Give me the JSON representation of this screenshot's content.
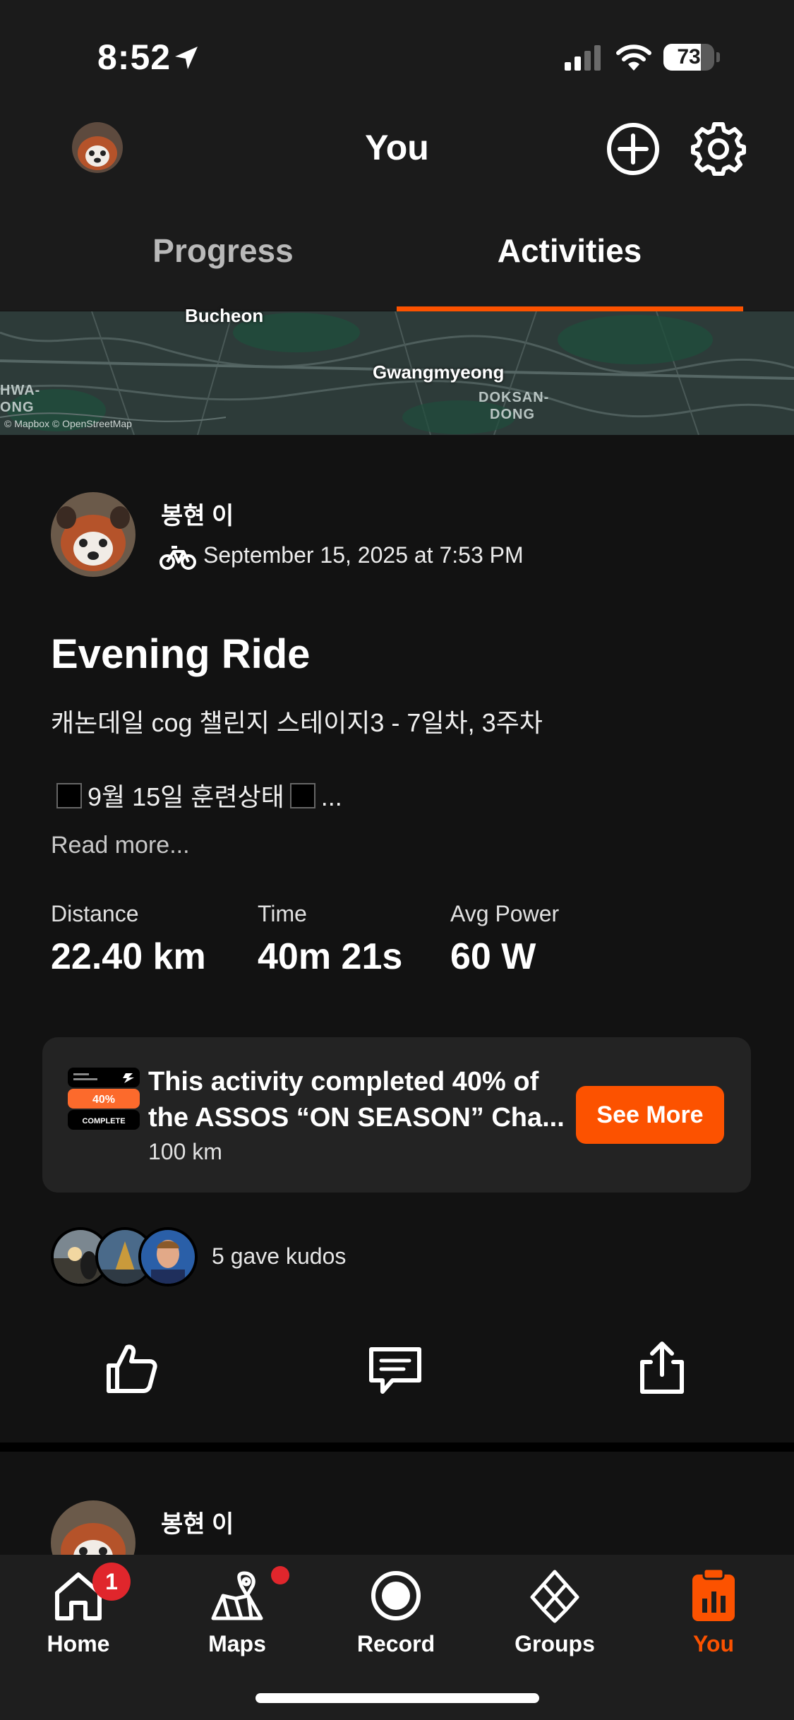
{
  "status_bar": {
    "time": "8:52",
    "battery": "73",
    "battery_level": 0.73
  },
  "header": {
    "title": "You",
    "tabs": [
      {
        "label": "Progress",
        "active": false
      },
      {
        "label": "Activities",
        "active": true
      }
    ],
    "icons": {
      "add": "plus-circle-icon",
      "settings": "gear-icon"
    }
  },
  "map": {
    "labels": [
      "Bucheon",
      "Gwangmyeong",
      "HWA-",
      "ONG",
      "DOKSAN-",
      "DONG"
    ],
    "attribution": "© Mapbox © OpenStreetMap"
  },
  "activity": {
    "author": "봉현 이",
    "date": "September 15, 2025 at 7:53 PM",
    "sport_icon": "bike-icon",
    "title": "Evening Ride",
    "description": "캐논데일 cog 챌린지 스테이지3 - 7일차, 3주차",
    "line2_text": "9월 15일 훈련상태",
    "line2_ellipsis": "...",
    "read_more": "Read more...",
    "stats": [
      {
        "label": "Distance",
        "value": "22.40 km"
      },
      {
        "label": "Time",
        "value": "40m 21s"
      },
      {
        "label": "Avg Power",
        "value": "60 W"
      }
    ],
    "challenge": {
      "text_line1": "This activity completed 40% of",
      "text_line2": "the ASSOS “ON SEASON” Cha...",
      "subtitle": "100 km",
      "badge_percent": "40%",
      "badge_label": "COMPLETE",
      "button": "See More"
    },
    "kudos_text": "5 gave kudos",
    "actions": [
      "thumbs-up-icon",
      "comment-icon",
      "share-icon"
    ]
  },
  "next_activity": {
    "author": "봉현 이"
  },
  "bottom_nav": {
    "items": [
      {
        "label": "Home",
        "icon": "home-icon",
        "badge": "1"
      },
      {
        "label": "Maps",
        "icon": "maps-icon"
      },
      {
        "label": "Record",
        "icon": "record-icon"
      },
      {
        "label": "Groups",
        "icon": "groups-icon"
      },
      {
        "label": "You",
        "icon": "you-icon",
        "active": true
      }
    ]
  },
  "colors": {
    "accent": "#fc5200",
    "background": "#121212",
    "header": "#1b1b1b",
    "badge_red": "#e0262c"
  }
}
